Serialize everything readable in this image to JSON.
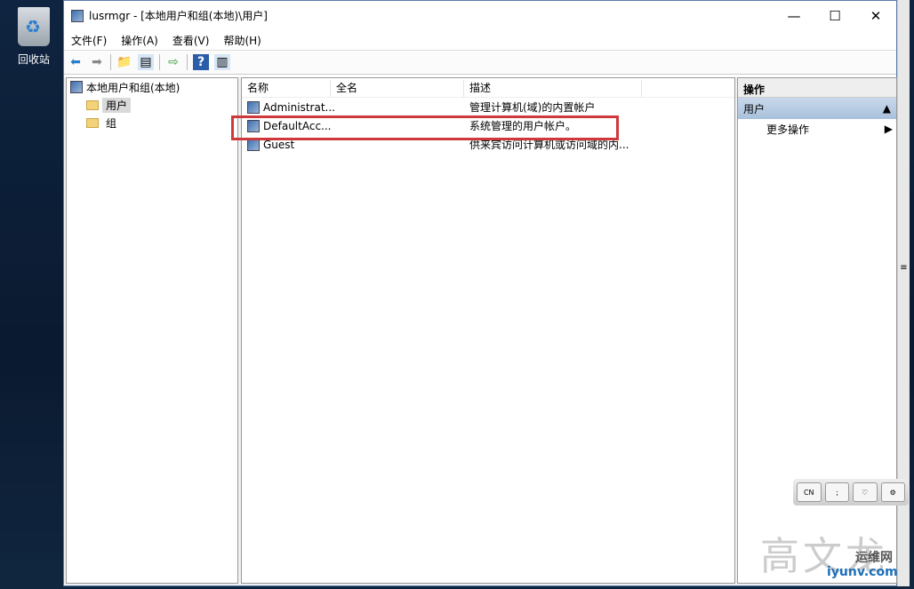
{
  "desktop": {
    "recycle_bin_label": "回收站"
  },
  "window": {
    "title": "lusrmgr - [本地用户和组(本地)\\用户]",
    "minimize": "—",
    "maximize": "☐",
    "close": "✕"
  },
  "menu": [
    "文件(F)",
    "操作(A)",
    "查看(V)",
    "帮助(H)"
  ],
  "tree": {
    "root": "本地用户和组(本地)",
    "items": [
      "用户",
      "组"
    ]
  },
  "list": {
    "columns": [
      "名称",
      "全名",
      "描述"
    ],
    "rows": [
      {
        "name": "Administrat...",
        "full_name": "",
        "description": "管理计算机(域)的内置帐户"
      },
      {
        "name": "DefaultAcc...",
        "full_name": "",
        "description": "系统管理的用户帐户。"
      },
      {
        "name": "Guest",
        "full_name": "",
        "description": "供来宾访问计算机或访问域的内..."
      }
    ]
  },
  "actions": {
    "header": "操作",
    "group": "用户",
    "more": "更多操作"
  },
  "ime": {
    "lang": "CN"
  },
  "watermark": {
    "text": "高文龙",
    "site": "运维网",
    "url": "iyunv.com"
  },
  "highlight_color": "#d0393b"
}
